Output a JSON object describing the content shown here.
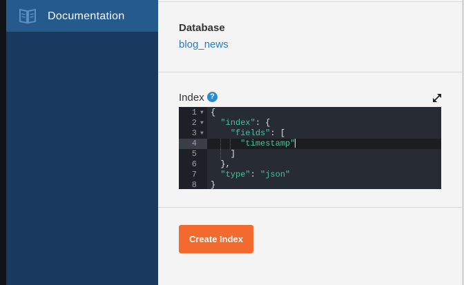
{
  "sidebar": {
    "documentation": {
      "label": "Documentation",
      "icon": "book-icon"
    }
  },
  "database": {
    "label": "Database",
    "value": "blog_news"
  },
  "index": {
    "label": "Index",
    "help_icon": "question-circle-icon",
    "help_glyph": "?",
    "expand_icon": "expand-arrows-icon",
    "editor_lines": [
      {
        "n": "1",
        "text": "{"
      },
      {
        "n": "2",
        "text": "  \"index\": {"
      },
      {
        "n": "3",
        "text": "    \"fields\": ["
      },
      {
        "n": "4",
        "text": "      \"timestamp\""
      },
      {
        "n": "5",
        "text": "    ]"
      },
      {
        "n": "6",
        "text": "  },"
      },
      {
        "n": "7",
        "text": "  \"type\": \"json\""
      },
      {
        "n": "8",
        "text": "}"
      }
    ]
  },
  "actions": {
    "create_label": "Create Index"
  },
  "colors": {
    "sidebar_bg": "#173a5e",
    "sidebar_active": "#255a8c",
    "link": "#2a7bbf",
    "accent": "#f26a2e",
    "editor_bg": "#272b33",
    "string": "#46c29e"
  }
}
